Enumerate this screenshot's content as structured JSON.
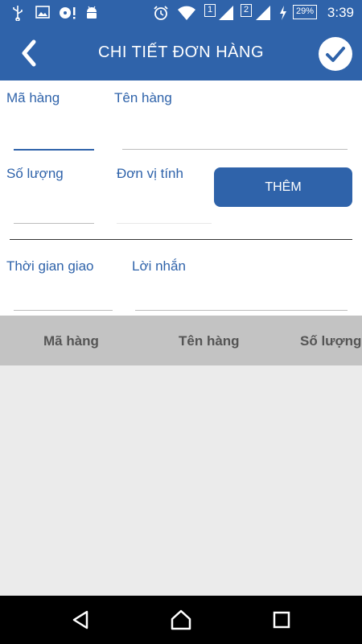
{
  "status_bar": {
    "sim1": "1",
    "sim2": "2",
    "battery": "29%",
    "time": "3:39"
  },
  "app_bar": {
    "title": "CHI TIẾT ĐƠN HÀNG"
  },
  "form": {
    "ma_hang_label": "Mã hàng",
    "ten_hang_label": "Tên hàng",
    "so_luong_label": "Số lượng",
    "don_vi_tinh_label": "Đơn vị tính",
    "add_button": "THÊM",
    "thoi_gian_giao_label": "Thời gian giao",
    "loi_nhan_label": "Lời nhắn"
  },
  "table": {
    "columns": [
      "Mã hàng",
      "Tên hàng",
      "Số lượng"
    ],
    "rows": []
  },
  "colors": {
    "primary": "#2f63aa",
    "header_bg": "#c3c3c3",
    "body_bg": "#ebebeb"
  }
}
